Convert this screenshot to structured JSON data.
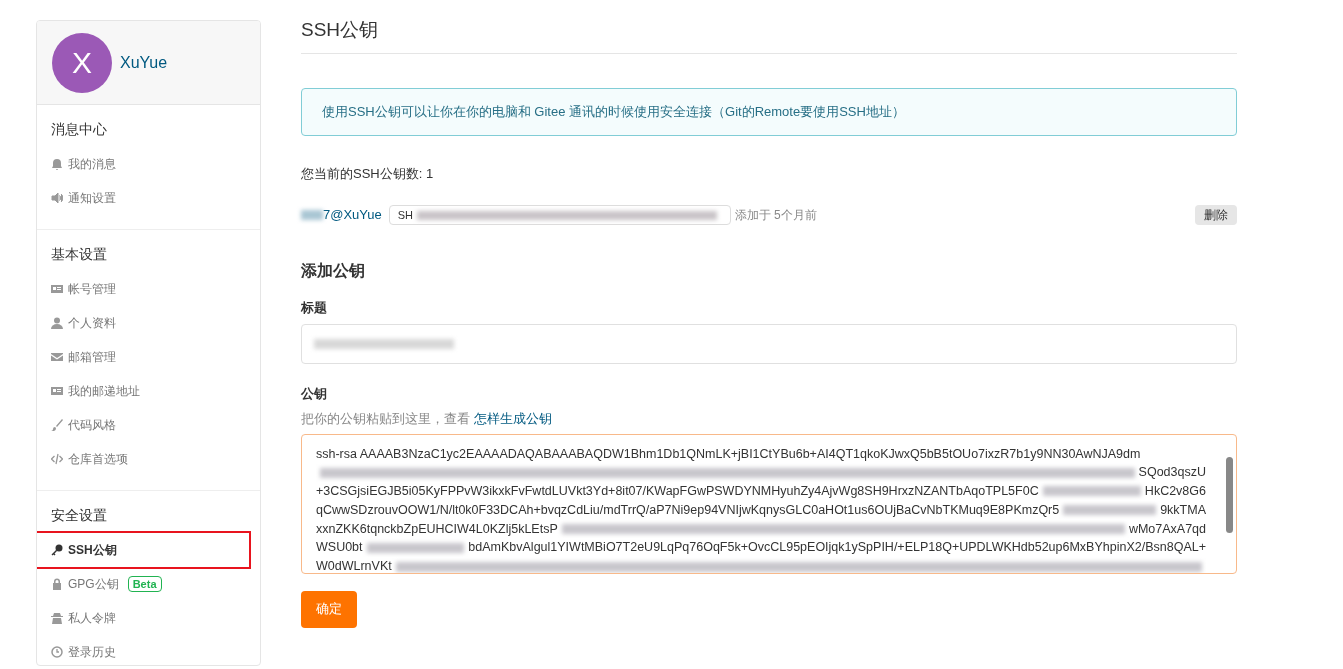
{
  "profile": {
    "avatar_letter": "X",
    "name": "XuYue"
  },
  "sidebar": [
    {
      "heading": "消息中心",
      "items": [
        {
          "label": "我的消息",
          "selected": false
        },
        {
          "label": "通知设置",
          "selected": false
        }
      ]
    },
    {
      "heading": "基本设置",
      "items": [
        {
          "label": "帐号管理",
          "selected": false
        },
        {
          "label": "个人资料",
          "selected": false
        },
        {
          "label": "邮箱管理",
          "selected": false
        },
        {
          "label": "我的邮递地址",
          "selected": false
        },
        {
          "label": "代码风格",
          "selected": false
        },
        {
          "label": "仓库首选项",
          "selected": false
        }
      ]
    },
    {
      "heading": "安全设置",
      "items": [
        {
          "label": "SSH公钥",
          "selected": true
        },
        {
          "label": "GPG公钥",
          "selected": false,
          "badge": "Beta"
        },
        {
          "label": "私人令牌",
          "selected": false
        },
        {
          "label": "登录历史",
          "selected": false
        }
      ]
    }
  ],
  "page_title": "SSH公钥",
  "info": "使用SSH公钥可以让你在你的电脑和 Gitee 通讯的时候使用安全连接（Git的Remote要使用SSH地址）",
  "key_count": "您当前的SSH公钥数: 1",
  "keys": [
    {
      "name": "7@XuYue",
      "fingerprint": "SH",
      "added": "添加于 5个月前",
      "delete": "删除"
    }
  ],
  "add_title": "添加公钥",
  "title_label": "标题",
  "key_label": "公钥",
  "key_hint": "把你的公钥粘贴到这里，查看",
  "key_hint_link": "怎样生成公钥",
  "key_lines": [
    {
      "segments": [
        "ssh-rsa AAAAB3NzaC1yc2EAAAADAQABAAABAQDW1Bhm1Db1QNmLK+jBI1CtYBu6b+AI4QT1qkoKJwxQ5bB5tOUo7ixzR7b1y9NN30AwNJA9dm"
      ]
    },
    {
      "segments": [
        "SQod3qszU"
      ],
      "leading_blur": true
    },
    {
      "segments": [
        "+3CSGjsiEGJB5i05KyFPPvW3ikxkFvFwtdLUVkt3Yd+8it07/KWapFGwPSWDYNMHyuhZy4AjvWg8SH9HrxzNZANTbAqoTPL5F0C",
        "HkC2v8G6"
      ]
    },
    {
      "segments": [
        "qCwwSDzrouvOOW1/N/lt0k0F33DCAh+bvqzCdLiu/mdTrrQ/aP7Ni9ep94VNIjwKqnysGLC0aHOt1us6OUjBaCvNbTKMuq9E8PKmzQr5",
        "9kkTMA"
      ]
    },
    {
      "segments": [
        "xxnZKK6tqnckbZpEUHCIW4L0KZlj5kLEtsP",
        "wMo7AxA7qd"
      ]
    },
    {
      "segments": [
        "WSU0bt",
        "bdAmKbvAlgul1YIWtMBiO7T2eU9LqPq76OqF5k+OvcCL95pEOIjqk1ySpPIH/+ELP18Q+UPDLWKHdb52up6MxBYhpinX2/Bsn8QAL+"
      ]
    },
    {
      "segments": [
        "W0dWLrnVKt"
      ],
      "trailing_blur": true
    }
  ],
  "submit": "确定"
}
